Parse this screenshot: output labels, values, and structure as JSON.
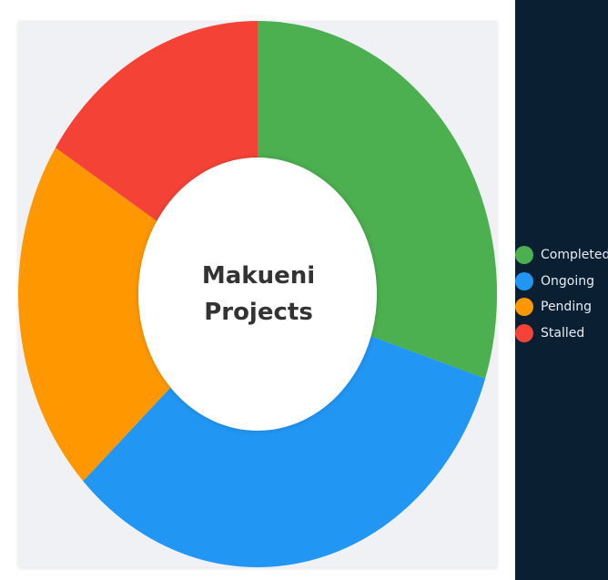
{
  "chart_data": {
    "type": "doughnut",
    "title_lines": [
      "Makueni",
      "Projects"
    ],
    "categories": [
      "Completed",
      "Ongoing",
      "Pending",
      "Stalled"
    ],
    "values": [
      30,
      33,
      21,
      16
    ],
    "colors": [
      "#4caf50",
      "#2196f3",
      "#ff9800",
      "#f44336"
    ],
    "legend_position": "right"
  },
  "legend": {
    "items": [
      {
        "label": "Completed",
        "color": "#4caf50"
      },
      {
        "label": "Ongoing",
        "color": "#2196f3"
      },
      {
        "label": "Pending",
        "color": "#ff9800"
      },
      {
        "label": "Stalled",
        "color": "#f44336"
      }
    ]
  },
  "theme": {
    "panel_color": "#0b1f33",
    "card_color": "#f0f1f5"
  }
}
